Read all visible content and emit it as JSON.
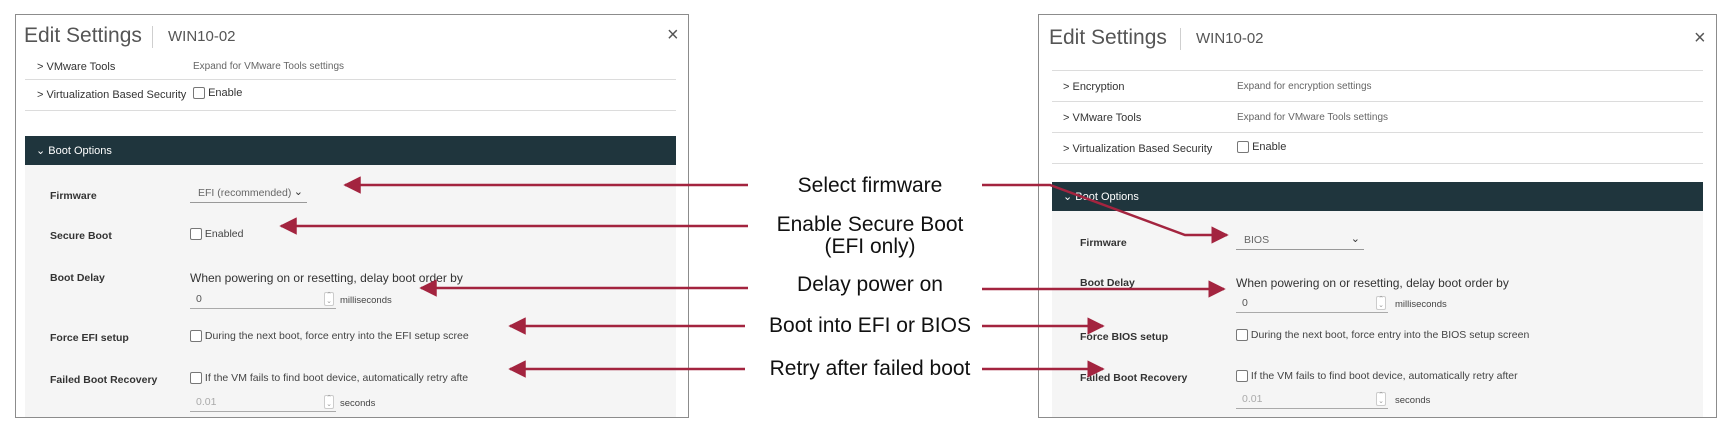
{
  "left_dialog": {
    "title": "Edit Settings",
    "vm_name": "WIN10-02",
    "close_glyph": "×",
    "rows": [
      {
        "label": "> VMware Tools",
        "value": "Expand for VMware Tools settings"
      },
      {
        "label": "> Virtualization Based Security",
        "value": "Enable"
      }
    ],
    "section": "⌄ Boot Options",
    "firmware": {
      "label": "Firmware",
      "value": "EFI (recommended)"
    },
    "secure_boot": {
      "label": "Secure Boot",
      "value": "Enabled"
    },
    "boot_delay": {
      "label": "Boot Delay",
      "desc": "When powering on or resetting, delay boot order by",
      "value": "0",
      "unit": "milliseconds"
    },
    "force_setup": {
      "label": "Force EFI setup",
      "text": "During the next boot, force entry into the EFI setup scree"
    },
    "failed_recovery": {
      "label": "Failed Boot Recovery",
      "text": "If the VM fails to find boot device, automatically retry afte",
      "value": "0.01",
      "unit": "seconds"
    }
  },
  "right_dialog": {
    "title": "Edit Settings",
    "vm_name": "WIN10-02",
    "close_glyph": "×",
    "rows": [
      {
        "label": "> Encryption",
        "value": "Expand for encryption settings"
      },
      {
        "label": "> VMware Tools",
        "value": "Expand for VMware Tools settings"
      },
      {
        "label": "> Virtualization Based Security",
        "value": "Enable"
      }
    ],
    "section": "⌄ Boot Options",
    "firmware": {
      "label": "Firmware",
      "value": "BIOS"
    },
    "boot_delay": {
      "label": "Boot Delay",
      "desc": "When powering on or resetting, delay boot order by",
      "value": "0",
      "unit": "milliseconds"
    },
    "force_setup": {
      "label": "Force BIOS setup",
      "text": "During the next boot, force entry into the BIOS setup screen"
    },
    "failed_recovery": {
      "label": "Failed Boot Recovery",
      "text": "If the VM fails to find boot device, automatically retry after",
      "value": "0.01",
      "unit": "seconds"
    }
  },
  "callouts": {
    "select_firmware": "Select firmware",
    "secure_boot_line1": "Enable Secure Boot",
    "secure_boot_line2": "(EFI only)",
    "delay_power_on": "Delay power on",
    "boot_into": "Boot into EFI or BIOS",
    "retry": "Retry after failed boot"
  },
  "colors": {
    "arrow": "#a3243f",
    "section_bg": "#1f353d"
  },
  "icons": {
    "close": "close-icon",
    "dropdown": "chevron-down-icon",
    "stepper": "stepper-icon"
  }
}
